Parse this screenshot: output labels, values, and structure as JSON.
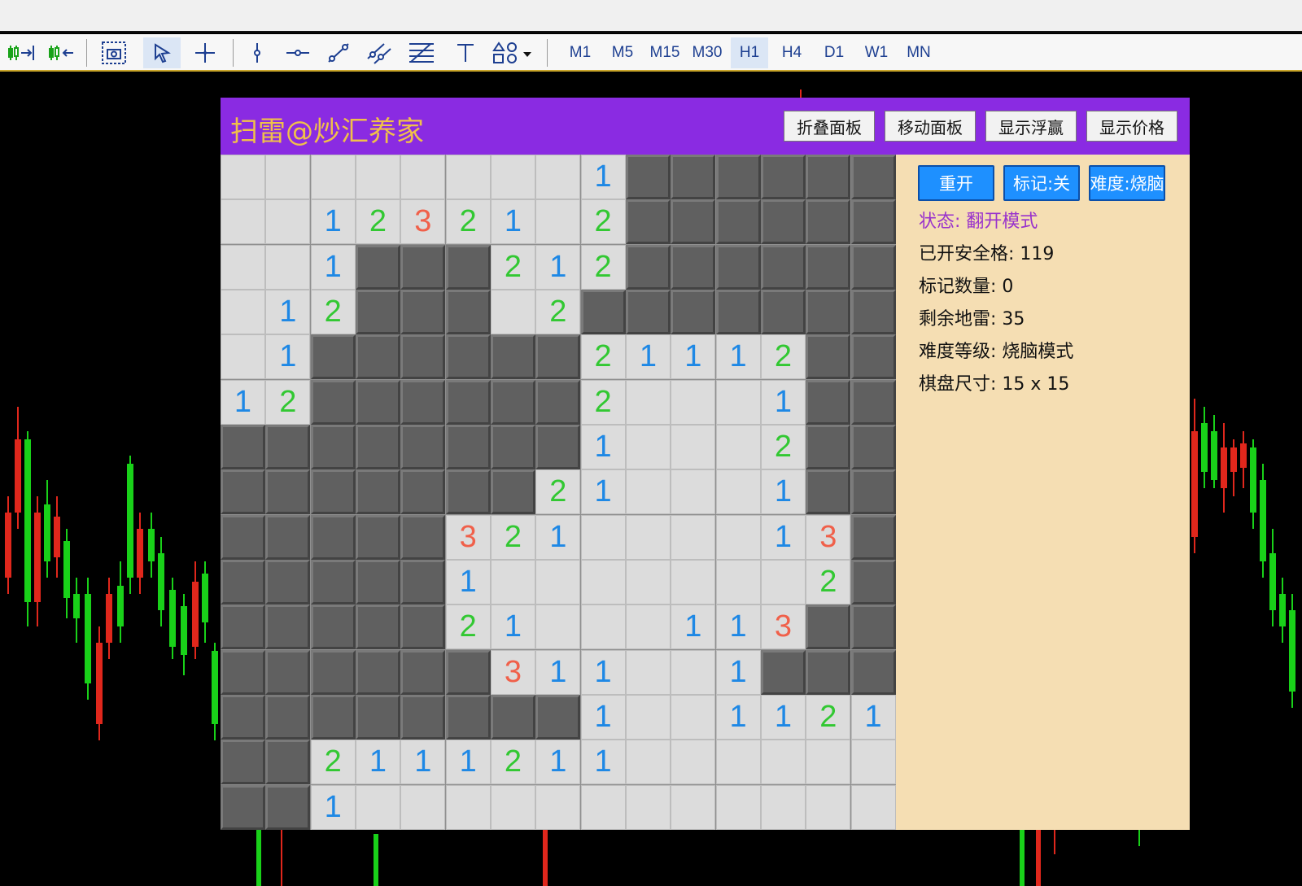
{
  "toolbar": {
    "timeframes": [
      "M1",
      "M5",
      "M15",
      "M30",
      "H1",
      "H4",
      "D1",
      "W1",
      "MN"
    ],
    "selected_timeframe": "H1"
  },
  "panel": {
    "title": "扫雷@炒汇养家",
    "buttons": {
      "collapse": "折叠面板",
      "move": "移动面板",
      "show_pnl": "显示浮赢",
      "show_price": "显示价格"
    }
  },
  "controls": {
    "restart": "重开",
    "mark": "标记:关",
    "difficulty": "难度:烧脑"
  },
  "status": {
    "label": "状态:",
    "value": "翻开模式"
  },
  "info": {
    "safe_opened_label": "已开安全格:",
    "safe_opened": "119",
    "marks_label": "标记数量:",
    "marks": "0",
    "mines_left_label": "剩余地雷:",
    "mines_left": "35",
    "level_label": "难度等级:",
    "level": "烧脑模式",
    "size_label": "棋盘尺寸:",
    "size": "15 x 15"
  },
  "board": {
    "rows": [
      "........1######",
      "..12321.2######",
      "..1###212######",
      ".12###.2#######",
      ".1######21112##",
      "12######2...1##",
      "########1...2##",
      "#######21...1##",
      "#####321....13#",
      "#####1.......2#",
      "#####21...113##",
      "######311..1###",
      "########1..1121",
      "##2111211......",
      "##1............"
    ]
  },
  "colors": {
    "n1": "#1e88e5",
    "n2": "#32c832",
    "n3": "#f0604a",
    "panel_header": "#8a2be2",
    "panel_body": "#f5deb3",
    "button_blue": "#1e90ff",
    "status_text": "#9932cc"
  }
}
